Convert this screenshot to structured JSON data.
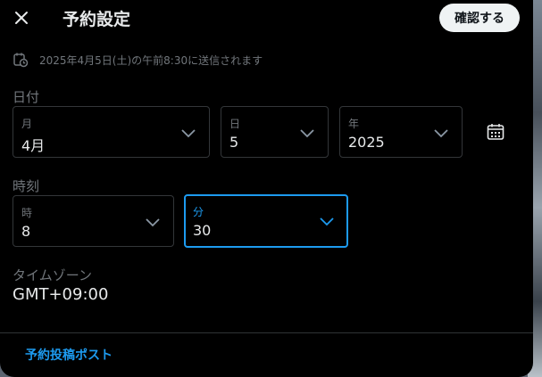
{
  "header": {
    "title": "予約設定",
    "confirm_label": "確認する"
  },
  "notice": {
    "text": "2025年4月5日(土)の午前8:30に送信されます"
  },
  "date": {
    "section_label": "日付",
    "month": {
      "label": "月",
      "value": "4月"
    },
    "day": {
      "label": "日",
      "value": "5"
    },
    "year": {
      "label": "年",
      "value": "2025"
    }
  },
  "time": {
    "section_label": "時刻",
    "hour": {
      "label": "時",
      "value": "8"
    },
    "minute": {
      "label": "分",
      "value": "30"
    }
  },
  "timezone": {
    "label": "タイムゾーン",
    "value": "GMT+09:00"
  },
  "footer": {
    "link_label": "予約投稿ポスト"
  },
  "colors": {
    "accent": "#1d9bf0",
    "background": "#000000",
    "text": "#e7e9ea",
    "muted": "#71767b",
    "border": "#333639"
  },
  "icons": [
    "close-icon",
    "clock-calendar-icon",
    "chevron-down-icon",
    "calendar-icon"
  ]
}
